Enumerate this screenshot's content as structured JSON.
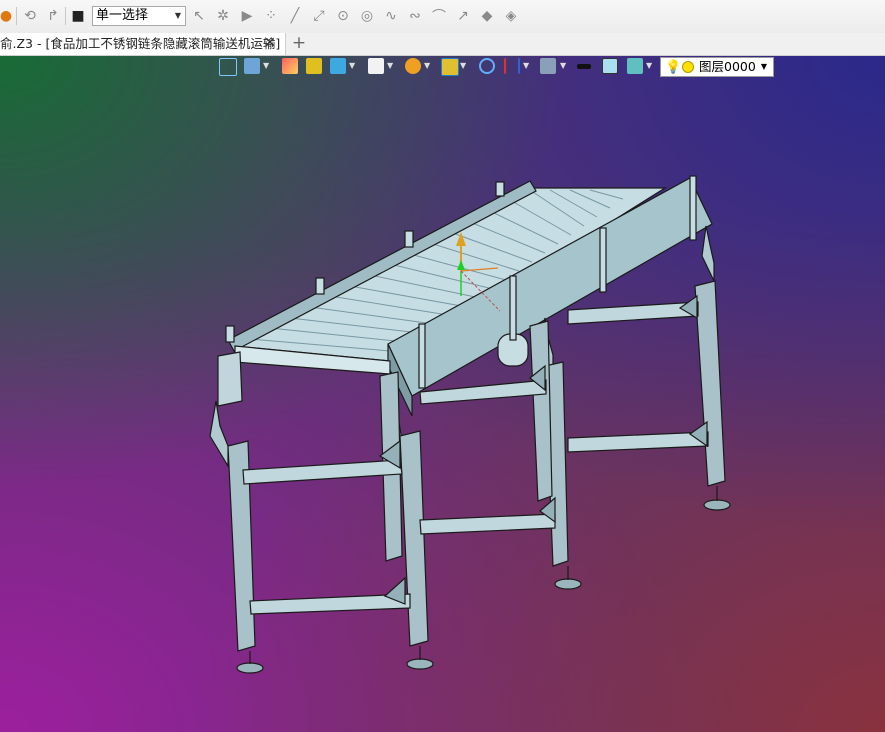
{
  "toolbar": {
    "selection_mode": "单一选择"
  },
  "document_tab": {
    "title": "俞.Z3 - [食品加工不锈钢链条隐藏滚筒输送机运输]",
    "close_label": "✕",
    "add_label": "+"
  },
  "view_toolbar": {
    "layer_label": "图层0000"
  },
  "colors": {
    "background_top_left": "#1a7a3a",
    "background_top_right": "#2a2a8c",
    "background_bottom_left": "#a020a0",
    "background_bottom_right": "#8c3232",
    "model_fill": "#b8d8e0",
    "model_edge": "#1a1a1a"
  }
}
